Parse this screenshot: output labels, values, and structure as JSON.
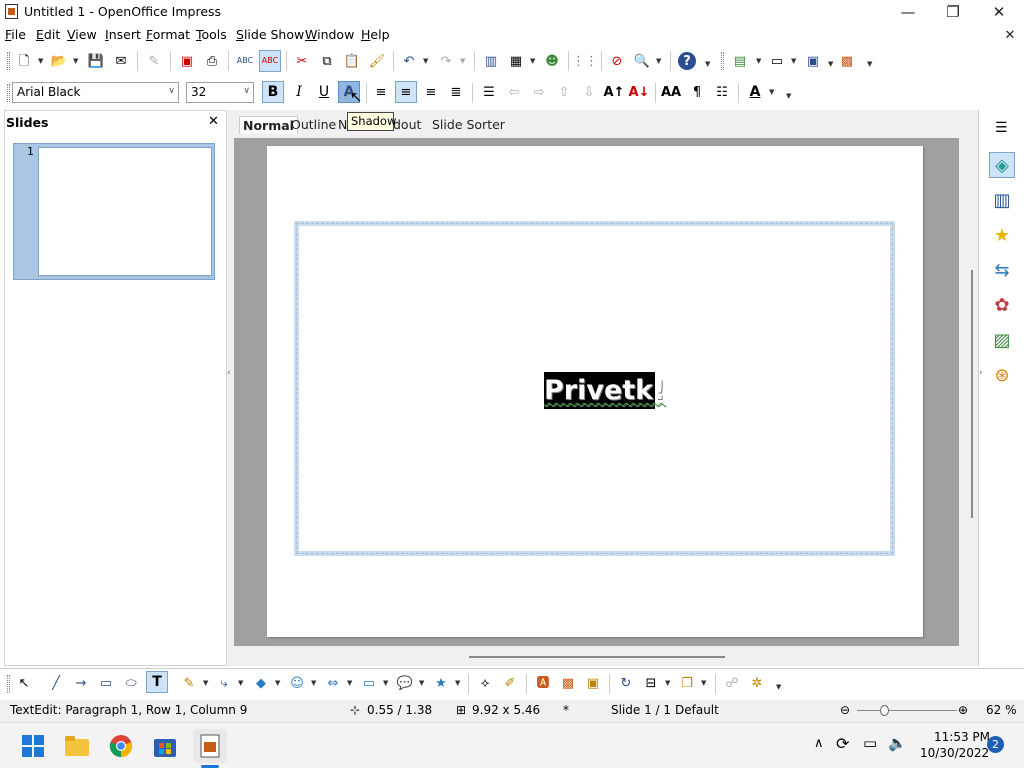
{
  "window": {
    "title": "Untitled 1 - OpenOffice Impress",
    "minimize": "—",
    "maximize": "❐",
    "close": "✕",
    "doc_close": "✕"
  },
  "menu": [
    "File",
    "Edit",
    "View",
    "Insert",
    "Format",
    "Tools",
    "Slide Show",
    "Window",
    "Help"
  ],
  "format_bar": {
    "font_name": "Arial Black",
    "font_size": "32",
    "bold": "B",
    "italic": "I",
    "underline": "U",
    "shadow": "A"
  },
  "tooltip": "Shadow",
  "slides_panel": {
    "title": "Slides",
    "close": "✕",
    "thumbnails": [
      {
        "number": "1"
      }
    ]
  },
  "view_tabs": [
    "Normal",
    "Outline",
    "N",
    "dout",
    "Slide Sorter"
  ],
  "slide": {
    "text": "Privetk!"
  },
  "statusbar": {
    "edit_info": "TextEdit: Paragraph 1, Row 1, Column 9",
    "position": "0.55 / 1.38",
    "size": "9.92 x 5.46",
    "modified": "*",
    "slide": "Slide 1 / 1",
    "layout": "Default",
    "zoom": "62 %"
  },
  "taskbar": {
    "time": "11:53 PM",
    "date": "10/30/2022",
    "notifications": "2"
  },
  "colors": {
    "accent": "#2a6cc4",
    "selection": "#aac6e2",
    "tooltip_bg": "#ffffe1"
  }
}
